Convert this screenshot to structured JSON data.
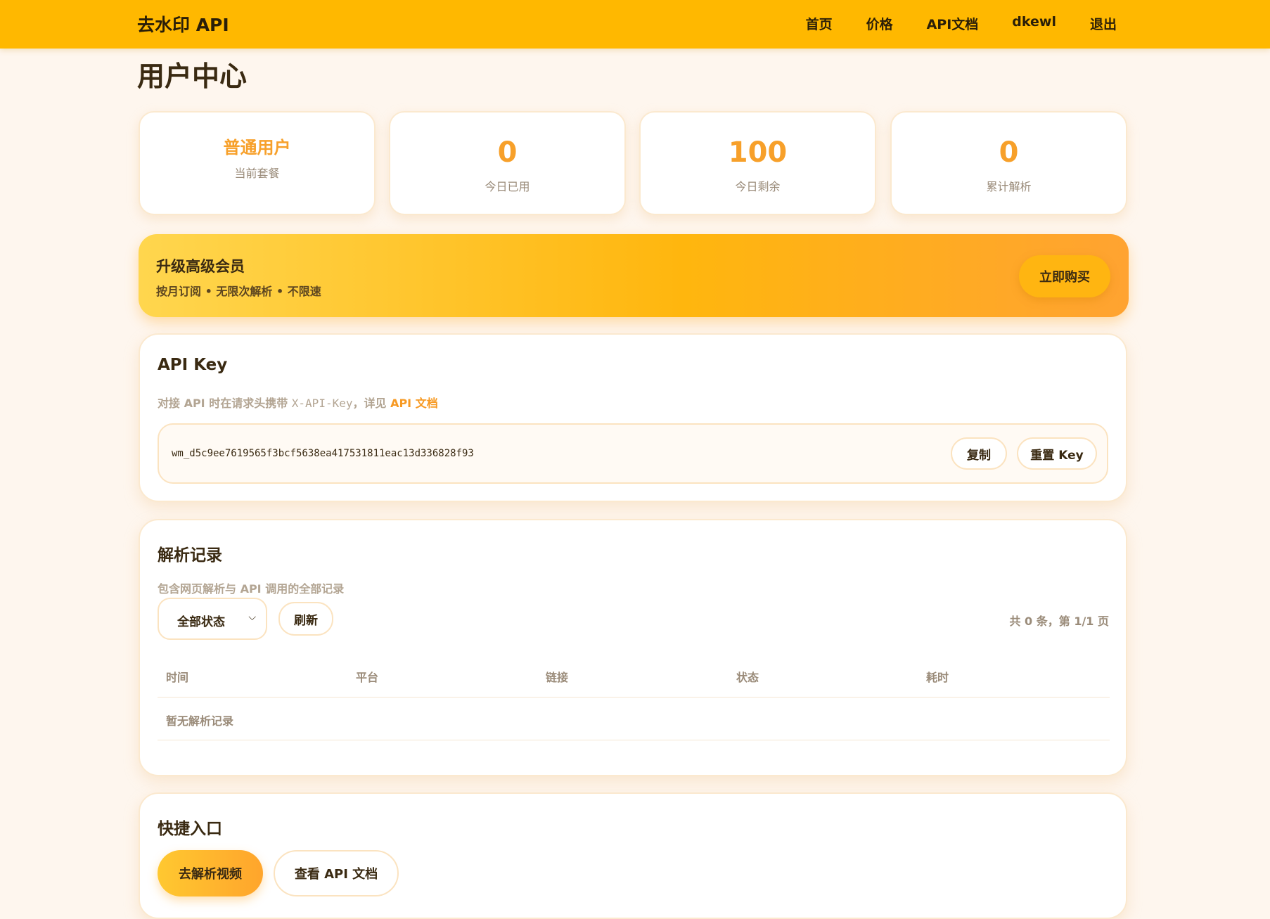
{
  "nav": {
    "brand": "去水印 API",
    "links": [
      "首页",
      "价格",
      "API文档",
      "dkewl",
      "退出"
    ]
  },
  "page": {
    "title": "用户中心"
  },
  "stats": [
    {
      "value": "普通用户",
      "label": "当前套餐"
    },
    {
      "value": "0",
      "label": "今日已用"
    },
    {
      "value": "100",
      "label": "今日剩余"
    },
    {
      "value": "0",
      "label": "累计解析"
    }
  ],
  "upgrade": {
    "title": "升级高级会员",
    "subtitle": "按月订阅 • 无限次解析 • 不限速",
    "button": "立即购买"
  },
  "api_key": {
    "title": "API Key",
    "desc_prefix": "对接 API 时在请求头携带 ",
    "header_name": "X-API-Key",
    "desc_middle": "，详见 ",
    "docs_link": "API 文档",
    "key": "wm_d5c9ee7619565f3bcf5638ea417531811eac13d336828f93",
    "copy_button": "复制",
    "reset_button": "重置 Key"
  },
  "records": {
    "title": "解析记录",
    "subtitle": "包含网页解析与 API 调用的全部记录",
    "filter": "全部状态",
    "refresh_button": "刷新",
    "pager": "共 0 条，第 1/1 页",
    "columns": [
      "时间",
      "平台",
      "链接",
      "状态",
      "耗时"
    ],
    "empty": "暂无解析记录"
  },
  "quick": {
    "title": "快捷入口",
    "primary_button": "去解析视频",
    "secondary_button": "查看 API 文档"
  },
  "colors": {
    "navbar": "#ffb800",
    "accent": "#f7a02a",
    "background": "#fef6ee"
  }
}
